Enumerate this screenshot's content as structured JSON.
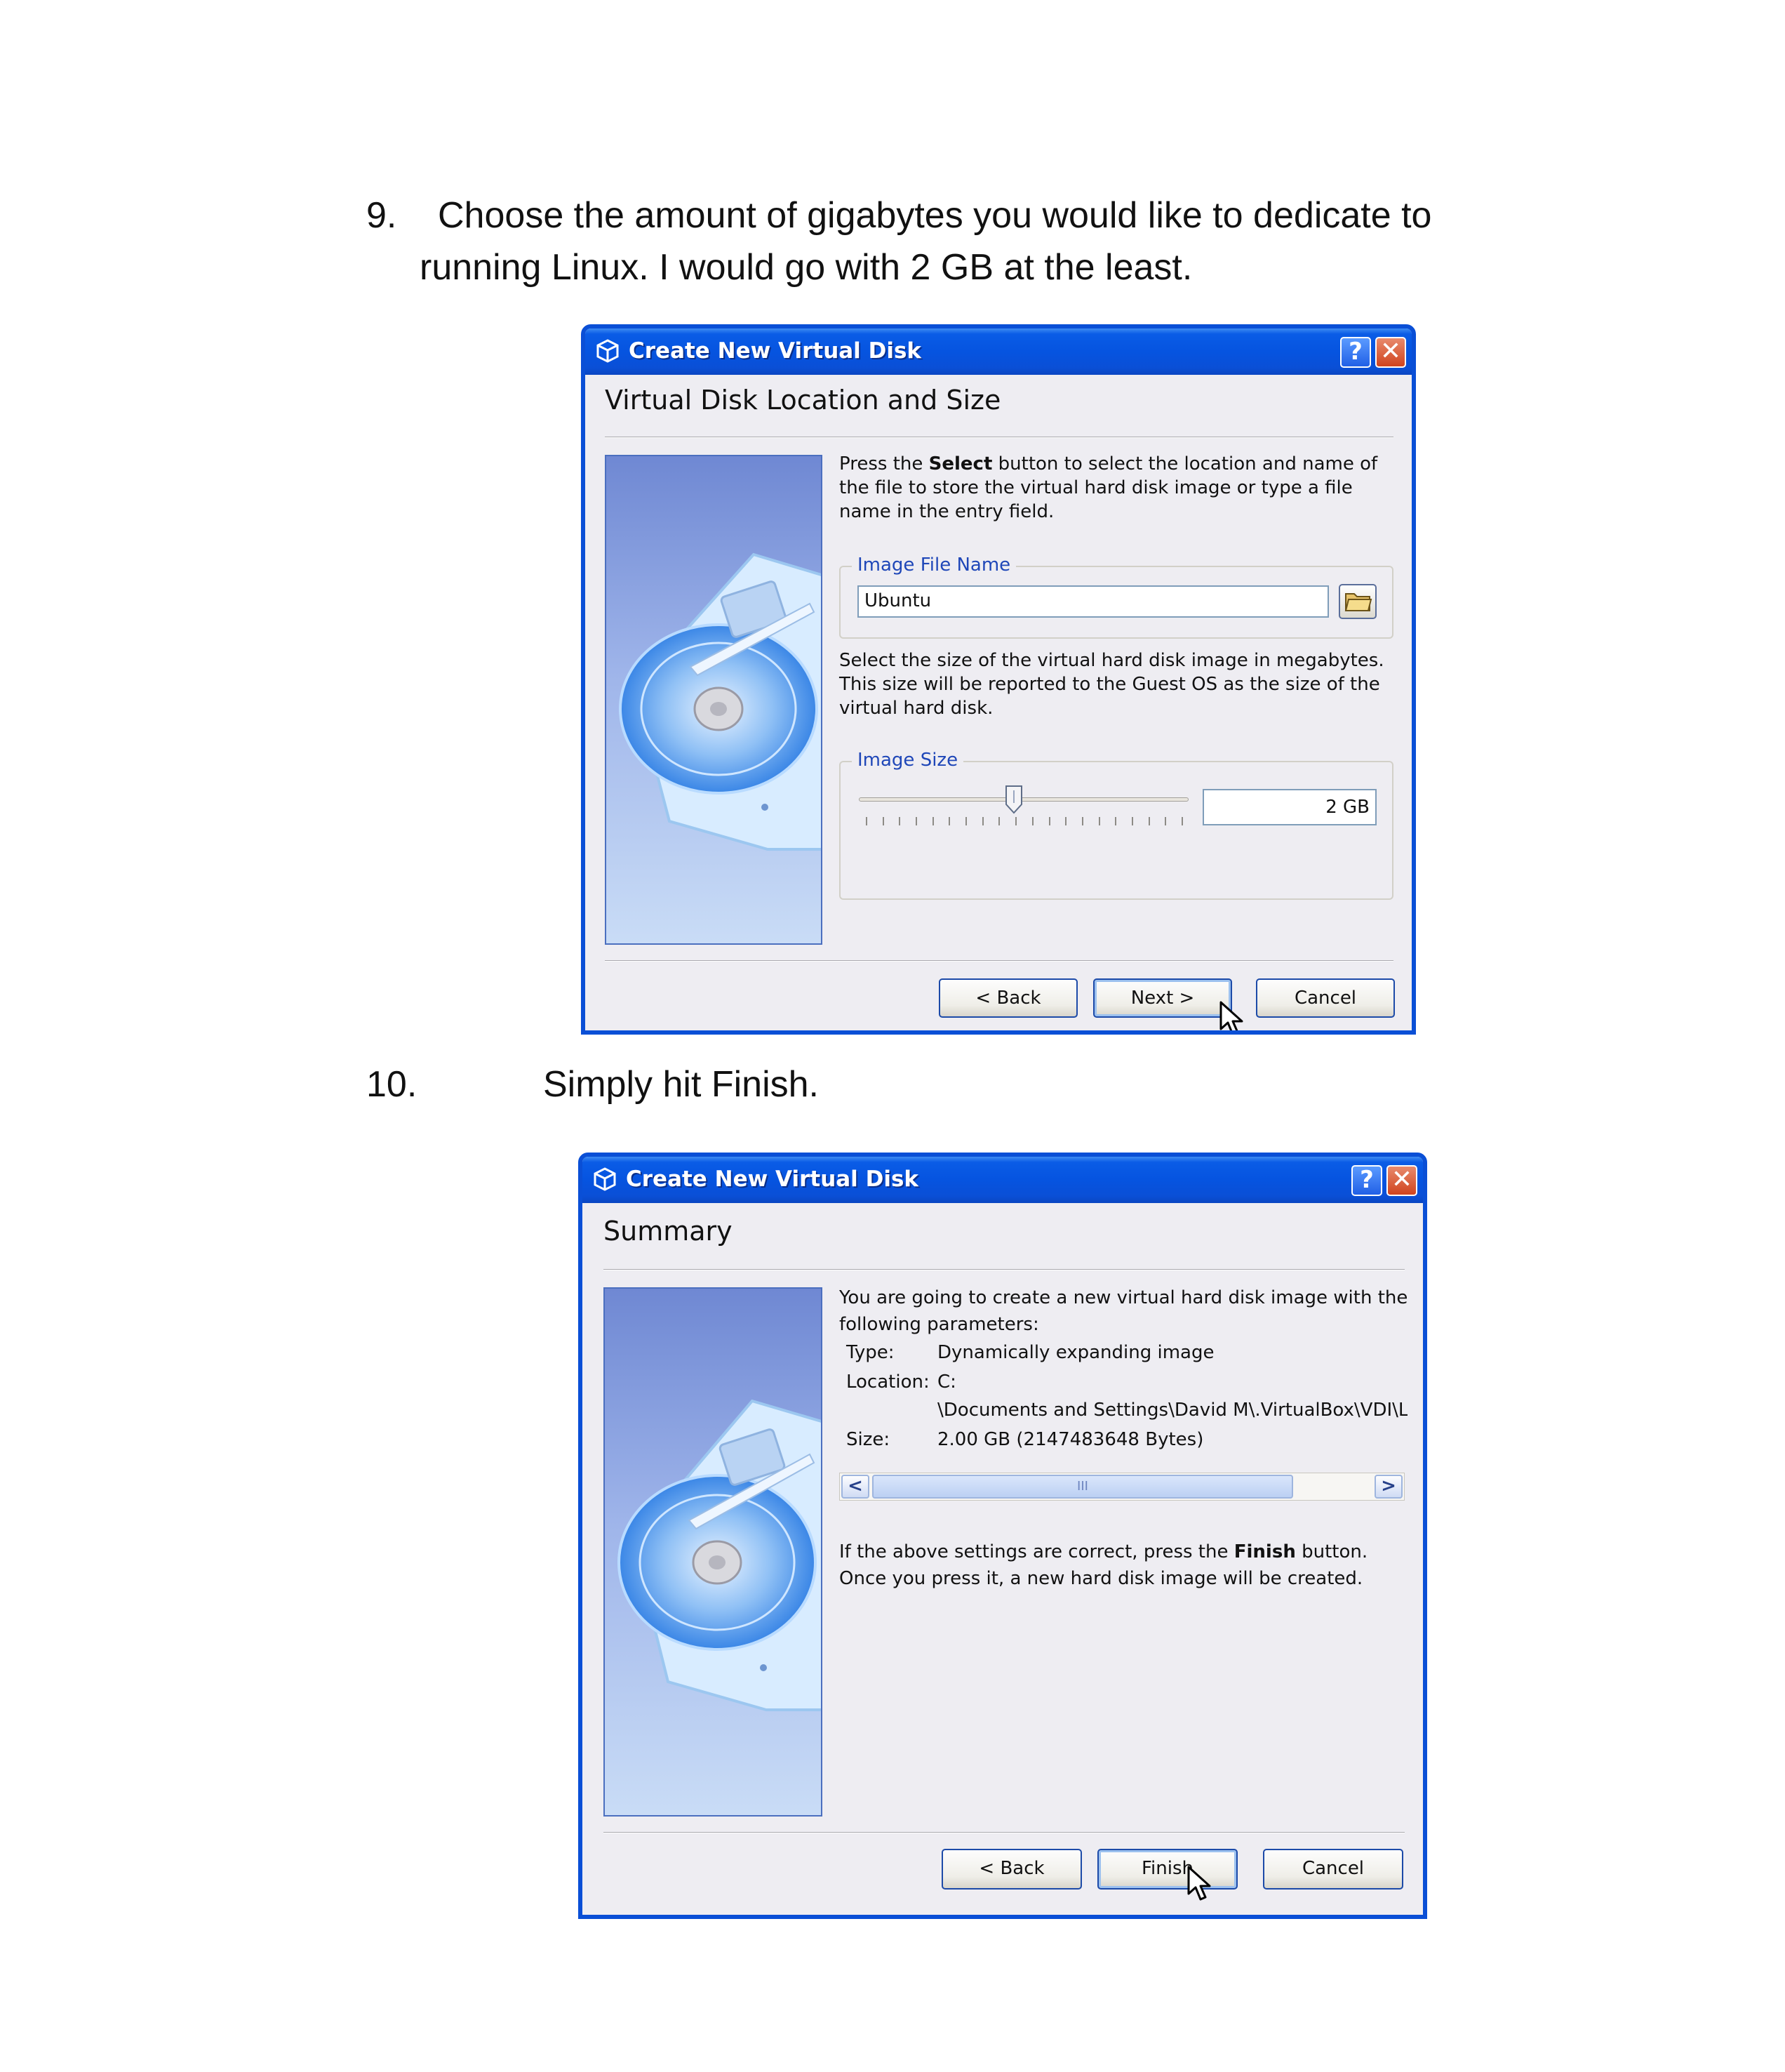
{
  "step9": {
    "number": "9.",
    "line1": "Choose the amount of gigabytes you would like to dedicate to",
    "line2": "running Linux. I would go with 2 GB at the least."
  },
  "step10": {
    "number": "10.",
    "text": "Simply hit Finish."
  },
  "dialog1": {
    "title": "Create New Virtual Disk",
    "help_glyph": "?",
    "close_glyph": "✕",
    "heading": "Virtual Disk Location and Size",
    "intro_before": "Press the ",
    "intro_bold": "Select",
    "intro_after": " button to select the location and name of the file to store the virtual hard disk image or type a file name in the entry field.",
    "image_file_group": "Image File Name",
    "image_file_value": "Ubuntu",
    "size_text": "Select the size of the virtual hard disk image in megabytes. This size will be reported to the Guest OS as the size of the virtual hard disk.",
    "image_size_group": "Image Size",
    "image_size_value": "2 GB",
    "slider_position_fraction": 0.47,
    "back_label": "< Back",
    "next_label": "Next >",
    "cancel_label": "Cancel"
  },
  "dialog2": {
    "title": "Create New Virtual Disk",
    "help_glyph": "?",
    "close_glyph": "✕",
    "heading": "Summary",
    "intro": "You are going to create a new virtual hard disk image with the following parameters:",
    "params": {
      "type_label": "Type:",
      "type_value": "Dynamically expanding image",
      "location_label": "Location:",
      "location_value_1": "C:",
      "location_value_2": "\\Documents and Settings\\David M\\.VirtualBox\\VDI\\L",
      "size_label": "Size:",
      "size_value": "2.00 GB (2147483648 Bytes)"
    },
    "scroll_left": "<",
    "scroll_right": ">",
    "scroll_grip": "III",
    "outro_before": "If the above settings are correct, press the ",
    "outro_bold": "Finish",
    "outro_after": " button.",
    "outro_line2": "Once you press it, a new hard disk image will be created.",
    "back_label": "< Back",
    "finish_label": "Finish",
    "cancel_label": "Cancel"
  },
  "colors": {
    "title_blue": "#0a4fd6",
    "dialog_bg": "#eeedf2",
    "group_legend": "#1f47b8"
  }
}
